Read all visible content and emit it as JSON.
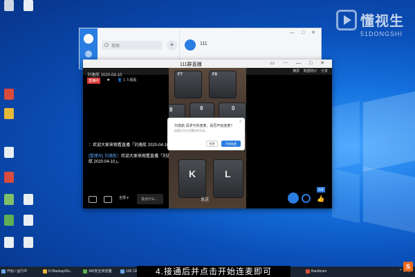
{
  "desktop": {
    "accent": "#1572e0",
    "icons": [
      {
        "name": "desktop-icon-1",
        "label": "",
        "color": "#cfd8e3"
      },
      {
        "name": "desktop-icon-2",
        "label": "",
        "color": "#e9eef3"
      },
      {
        "name": "desktop-icon-3",
        "label": "",
        "color": "#d94b3c"
      },
      {
        "name": "desktop-icon-4",
        "label": "",
        "color": "#e5b93a"
      },
      {
        "name": "desktop-icon-5",
        "label": "",
        "color": "#e9eef3"
      },
      {
        "name": "desktop-icon-6",
        "label": "",
        "color": "#d94b3c"
      },
      {
        "name": "desktop-icon-7",
        "label": "",
        "color": "#7fbf6a"
      },
      {
        "name": "desktop-icon-8",
        "label": "",
        "color": "#e9eef3"
      },
      {
        "name": "desktop-icon-9",
        "label": "",
        "color": "#5fae57"
      },
      {
        "name": "desktop-icon-10",
        "label": "",
        "color": "#e9eef3"
      },
      {
        "name": "desktop-icon-11",
        "label": "",
        "color": "#e9eef3"
      },
      {
        "name": "desktop-icon-12",
        "label": "",
        "color": "#e9eef3"
      }
    ]
  },
  "watermark": {
    "cn": "懂视生",
    "en": "51DONGSHI"
  },
  "chat_window": {
    "search_placeholder": "搜索",
    "plus": "+",
    "contact_name": "111",
    "controls": "— □ ✕"
  },
  "live_window": {
    "title": "111群直播",
    "controls": "▭ ⋯ — □ ✕",
    "topbar": [
      "横屏",
      "数据统计",
      "分享"
    ],
    "host_name": "刘逸航 2020-04-10",
    "host_tag": "直播中",
    "host_star": "★",
    "viewer_count": "1 人观看",
    "messages": [
      {
        "who": "",
        "text": "：欢迎大家来观看直播「刘逸航 2020-04-10」"
      },
      {
        "who": "[管理员] 刘逸航",
        "text": "：欢迎大家来观看直播「刘逸航 2020-04-10」。"
      }
    ],
    "video_keys": [
      "F7",
      "F8",
      "8",
      "9",
      "0",
      "K",
      "L"
    ],
    "dialog": {
      "title": "刘逸航 请求与你连麦，是否开始连麦？",
      "desc": "连麦后可与主播实时互动。",
      "cancel": "拒绝",
      "ok": "开始连麦",
      "close": "✕"
    },
    "bottom": {
      "select": "全部 ▾",
      "input_placeholder": "说点什么...",
      "send": "发送",
      "side_label": "连麦",
      "like": "👍"
    }
  },
  "caption": "4.接通后并点击开始连麦即可",
  "taskbar": {
    "items": [
      {
        "label": "开始 / 运行中",
        "color": "#6aa5e8"
      },
      {
        "label": "D:\\Backup\\Do...",
        "color": "#e5b93a"
      },
      {
        "label": "360安全浏览器",
        "color": "#5fae57"
      },
      {
        "label": "109 120",
        "color": "#6aa5e8"
      },
      {
        "label": "111群直播",
        "color": "#2a7de1"
      },
      {
        "label": "Bandicam",
        "color": "#d94b3c"
      }
    ],
    "tray": "⌃ ♪ 中",
    "s_logo": "S"
  }
}
